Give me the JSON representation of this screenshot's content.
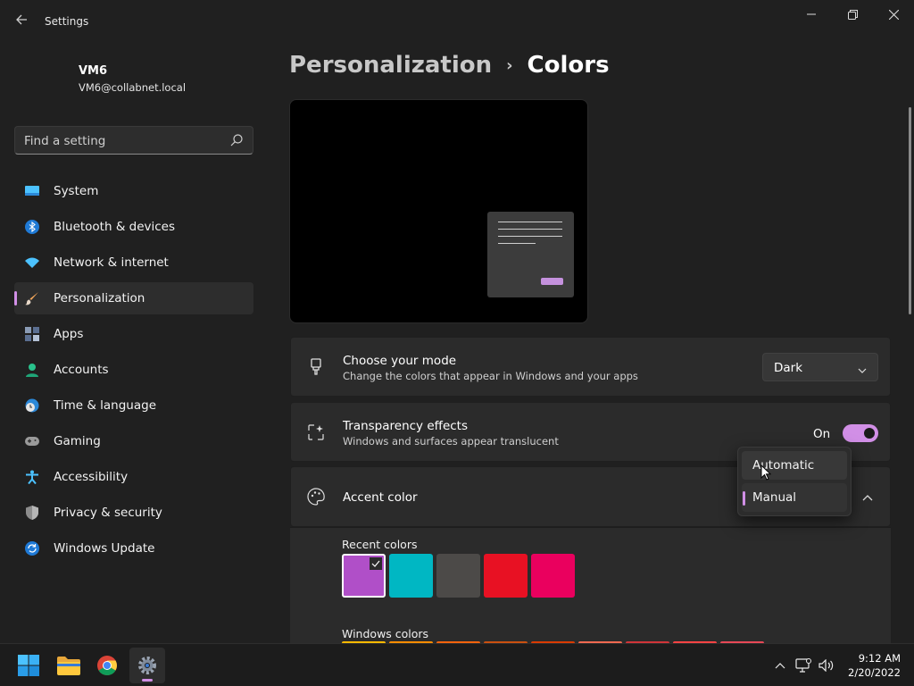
{
  "window": {
    "title": "Settings"
  },
  "profile": {
    "name": "VM6",
    "email": "VM6@collabnet.local"
  },
  "search": {
    "placeholder": "Find a setting"
  },
  "sidebar": {
    "items": [
      {
        "label": "System",
        "icon": "system-icon"
      },
      {
        "label": "Bluetooth & devices",
        "icon": "bluetooth-icon"
      },
      {
        "label": "Network & internet",
        "icon": "wifi-icon"
      },
      {
        "label": "Personalization",
        "icon": "brush-icon",
        "active": true
      },
      {
        "label": "Apps",
        "icon": "apps-icon"
      },
      {
        "label": "Accounts",
        "icon": "accounts-icon"
      },
      {
        "label": "Time & language",
        "icon": "clock-globe-icon"
      },
      {
        "label": "Gaming",
        "icon": "gamepad-icon"
      },
      {
        "label": "Accessibility",
        "icon": "accessibility-icon"
      },
      {
        "label": "Privacy & security",
        "icon": "shield-icon"
      },
      {
        "label": "Windows Update",
        "icon": "update-icon"
      }
    ]
  },
  "breadcrumb": {
    "parent": "Personalization",
    "separator": "›",
    "current": "Colors"
  },
  "mode": {
    "title": "Choose your mode",
    "description": "Change the colors that appear in Windows and your apps",
    "value": "Dark"
  },
  "transparency": {
    "title": "Transparency effects",
    "description": "Windows and surfaces appear translucent",
    "state_label": "On",
    "on": true
  },
  "accent": {
    "title": "Accent color",
    "dropdown_options": [
      "Automatic",
      "Manual"
    ],
    "selected_option": "Manual",
    "recent_label": "Recent colors",
    "recent_colors": [
      "#b04fc8",
      "#00b7c3",
      "#4c4a48",
      "#e81123",
      "#ea005e"
    ],
    "windows_label": "Windows colors",
    "windows_colors": [
      "#ffb900",
      "#ff8c00",
      "#f7630c",
      "#ca5010",
      "#da3b01",
      "#ef6950",
      "#d13438",
      "#ff4343",
      "#e74856"
    ]
  },
  "colors": {
    "accent": "#d18fe6",
    "background": "#202020",
    "card": "#2b2b2b"
  },
  "taskbar": {
    "apps": [
      "start-icon",
      "file-explorer-icon",
      "chrome-icon",
      "settings-icon"
    ],
    "time": "9:12 AM",
    "date": "2/20/2022"
  }
}
